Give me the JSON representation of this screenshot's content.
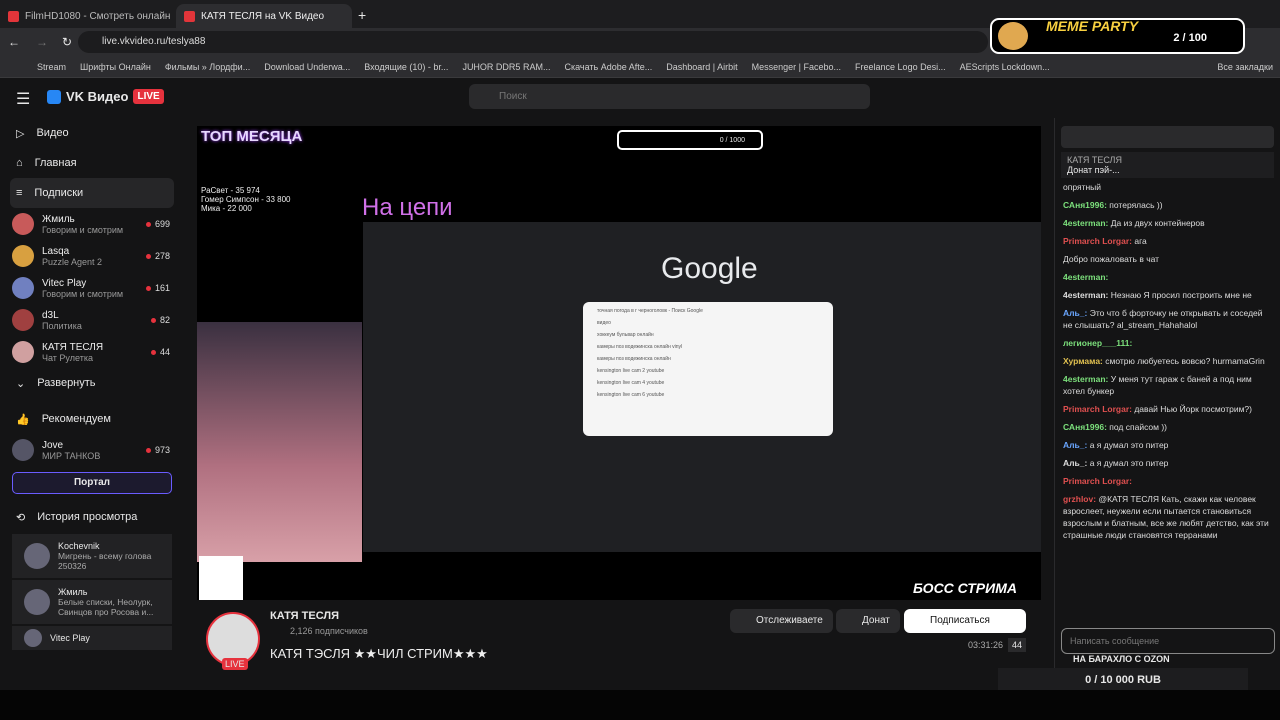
{
  "tabs": [
    {
      "label": "FilmHD1080 - Смотреть онлайн"
    },
    {
      "label": "КАТЯ ТЕСЛЯ на VK Видео"
    }
  ],
  "url": "live.vkvideo.ru/teslya88",
  "bookmarks": [
    "Stream",
    "Шрифты Онлайн",
    "Фильмы » Лордфи...",
    "Download Underwa...",
    "Входящие (10) - br...",
    "JUHOR DDR5 RAM...",
    "Скачать Adobe Afte...",
    "Dashboard | Airbit",
    "Messenger | Facebo...",
    "Freelance Logo Desi...",
    "AEScripts Lockdown...",
    "Все закладки"
  ],
  "header": {
    "brand": "VK Видео",
    "live": "LIVE",
    "search_placeholder": "Поиск"
  },
  "sidebar": {
    "nav": [
      {
        "label": "Видео"
      },
      {
        "label": "Главная"
      },
      {
        "label": "Подписки"
      }
    ],
    "channels": [
      {
        "name": "Жмиль",
        "sub": "Говорим и смотрим",
        "count": "699",
        "color": "#c85a5a"
      },
      {
        "name": "Lasqa",
        "sub": "Puzzle Agent 2",
        "count": "278",
        "color": "#d8a040"
      },
      {
        "name": "Vitec Play",
        "sub": "Говорим и смотрим",
        "count": "161",
        "color": "#7080c0"
      },
      {
        "name": "d3L",
        "sub": "Политика",
        "count": "82",
        "color": "#a04040"
      },
      {
        "name": "КАТЯ ТЕСЛЯ",
        "sub": "Чат Рулетка",
        "count": "44",
        "color": "#d0a0a0"
      }
    ],
    "expand": "Развернуть",
    "recommend": "Рекомендуем",
    "rec": {
      "name": "Jove",
      "sub": "МИР ТАНКОВ",
      "count": "973"
    },
    "portal": "Портал",
    "history": "История просмотра",
    "hist": [
      {
        "name": "Kochevnik",
        "sub": "Мигрень - всему голова 250326"
      },
      {
        "name": "Жмиль",
        "sub": "Белые списки, Неолурк, Свинцов про Росова и..."
      },
      {
        "name": "Vitec Play",
        "sub": ""
      }
    ]
  },
  "video": {
    "top": "ТОП МЕСЯЦА",
    "na": "На цепи",
    "google": "Google",
    "boss": "БОСС СТРИМА",
    "donors": [
      "РаСвет - 35 974",
      "Гомер Симпсон - 33 800",
      "Мика - 22 000"
    ],
    "meme_count": "0 / 1000",
    "suggestions": [
      "точная погода в г черноголовк - Поиск Google",
      "видео",
      "хоккеум бульвар онлайн",
      "камеры поз водежинска онлайн vinyl",
      "камеры поз водежинска онлайн",
      "kensington live cam 2 youtube",
      "kensington live cam 4 youtube",
      "kensington live cam 6 youtube"
    ]
  },
  "stream": {
    "channel": "КАТЯ ТЕСЛЯ",
    "subs": "2,126 подписчиков",
    "title": "КАТЯ ТЭСЛЯ ★★ЧИЛ СТРИМ★★★",
    "time": "03:31:26",
    "viewers": "44",
    "follow": "Отслеживаете",
    "donate": "Донат",
    "subscribe": "Подписаться"
  },
  "chat": {
    "pinned_name": "КАТЯ ТЕСЛЯ",
    "pinned_text": "Донат пэй-...",
    "placeholder": "Написать сообщение",
    "messages": [
      {
        "u": "",
        "t": "опрятный",
        "c": ""
      },
      {
        "u": "САня1996:",
        "t": "потерялась ))",
        "c": "g"
      },
      {
        "u": "4esterman:",
        "t": "Да из двух контейнеров",
        "c": "g"
      },
      {
        "u": "Primarch Lorgar:",
        "t": "ага",
        "c": "r"
      },
      {
        "u": "",
        "t": "Добро пожаловать в чат",
        "c": ""
      },
      {
        "u": "4esterman:",
        "t": "",
        "c": "g"
      },
      {
        "u": "4esterman:",
        "t": "Незнаю Я просил построить мне не",
        "c": ""
      },
      {
        "u": "Аль_:",
        "t": "Это что б форточку не открывать и соседей не слышать? al_stream_Hahahalol",
        "c": "b"
      },
      {
        "u": "легионер___111:",
        "t": "",
        "c": "g"
      },
      {
        "u": "Хурмама:",
        "t": "смотрю любуетесь вовсю? hurmamaGrin",
        "c": "y"
      },
      {
        "u": "4esterman:",
        "t": "У меня тут гараж с баней а под ним хотел бункер",
        "c": "g"
      },
      {
        "u": "Primarch Lorgar:",
        "t": "давай Нью Йорк посмотрим?)",
        "c": "r"
      },
      {
        "u": "САня1996:",
        "t": "под спайсом ))",
        "c": "g"
      },
      {
        "u": "Аль_:",
        "t": "а я думал это питер",
        "c": "b"
      },
      {
        "u": "Аль_:",
        "t": "а я думал это питер",
        "c": ""
      },
      {
        "u": "Primarch Lorgar:",
        "t": "",
        "c": "r"
      },
      {
        "u": "grzhlov:",
        "t": "@КАТЯ ТЕСЛЯ Кать, скажи как человек взрослеет, неужели если пытается становиться взрослым и блатным, все же любят детство, как эти страшные люди становятся терранами",
        "c": "r"
      }
    ],
    "banner": "НА БАРАХЛО С OZON"
  },
  "overlay": {
    "meme": "MEME PARTY",
    "meme_count": "2 / 100",
    "rub": "0 / 10 000 RUB"
  }
}
